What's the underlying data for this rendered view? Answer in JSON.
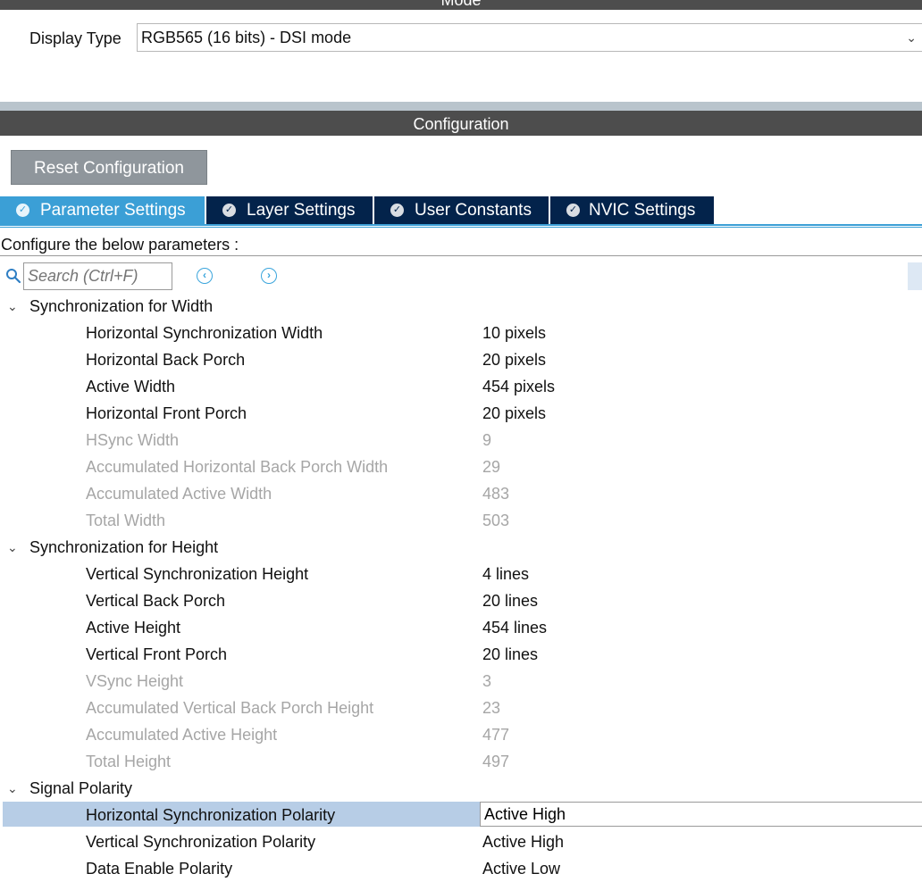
{
  "mode": {
    "header": "Mode"
  },
  "display_type": {
    "label": "Display Type",
    "value": "RGB565 (16 bits) - DSI mode"
  },
  "configuration": {
    "header": "Configuration",
    "reset_button": "Reset Configuration"
  },
  "tabs": [
    {
      "label": "Parameter Settings",
      "active": true
    },
    {
      "label": "Layer Settings",
      "active": false
    },
    {
      "label": "User Constants",
      "active": false
    },
    {
      "label": "NVIC Settings",
      "active": false
    }
  ],
  "configure_text": "Configure the below parameters :",
  "search": {
    "placeholder": "Search (Ctrl+F)"
  },
  "groups": [
    {
      "title": "Synchronization for Width",
      "params": [
        {
          "name": "Horizontal Synchronization Width",
          "value": "10 pixels",
          "enabled": true
        },
        {
          "name": "Horizontal Back Porch",
          "value": "20 pixels",
          "enabled": true
        },
        {
          "name": "Active Width",
          "value": "454 pixels",
          "enabled": true
        },
        {
          "name": "Horizontal Front Porch",
          "value": "20 pixels",
          "enabled": true
        },
        {
          "name": "HSync Width",
          "value": "9",
          "enabled": false
        },
        {
          "name": "Accumulated Horizontal Back Porch Width",
          "value": "29",
          "enabled": false
        },
        {
          "name": "Accumulated Active Width",
          "value": "483",
          "enabled": false
        },
        {
          "name": "Total Width",
          "value": "503",
          "enabled": false
        }
      ]
    },
    {
      "title": "Synchronization for Height",
      "params": [
        {
          "name": "Vertical Synchronization Height",
          "value": "4 lines",
          "enabled": true
        },
        {
          "name": "Vertical Back Porch",
          "value": "20 lines",
          "enabled": true
        },
        {
          "name": "Active Height",
          "value": "454 lines",
          "enabled": true
        },
        {
          "name": "Vertical Front Porch",
          "value": "20 lines",
          "enabled": true
        },
        {
          "name": "VSync Height",
          "value": "3",
          "enabled": false
        },
        {
          "name": "Accumulated Vertical Back Porch Height",
          "value": "23",
          "enabled": false
        },
        {
          "name": "Accumulated Active Height",
          "value": "477",
          "enabled": false
        },
        {
          "name": "Total Height",
          "value": "497",
          "enabled": false
        }
      ]
    },
    {
      "title": "Signal Polarity",
      "params": [
        {
          "name": "Horizontal Synchronization Polarity",
          "value": "Active High",
          "enabled": true,
          "selected": true
        },
        {
          "name": "Vertical Synchronization Polarity",
          "value": "Active High",
          "enabled": true
        },
        {
          "name": "Data Enable Polarity",
          "value": "Active Low",
          "enabled": true
        }
      ]
    }
  ]
}
